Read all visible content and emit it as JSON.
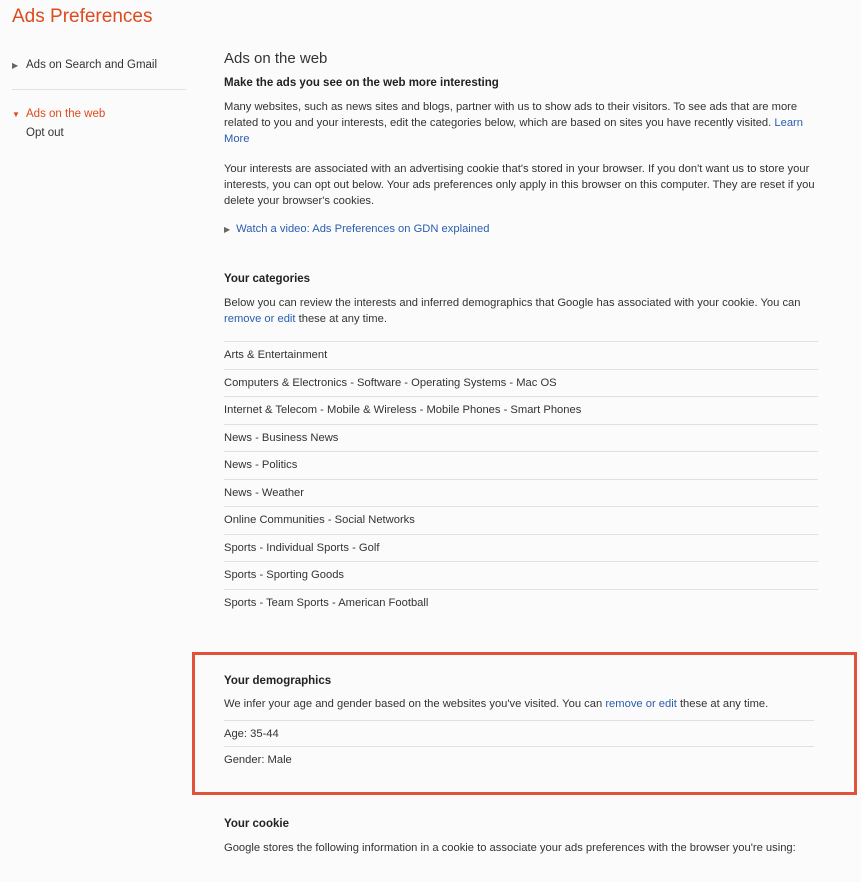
{
  "page": {
    "title": "Ads Preferences"
  },
  "sidebar": {
    "items": [
      {
        "label": "Ads on Search and Gmail"
      },
      {
        "label": "Ads on the web"
      }
    ],
    "sub_items": [
      {
        "label": "Opt out"
      }
    ]
  },
  "main": {
    "title": "Ads on the web",
    "subtitle": "Make the ads you see on the web more interesting",
    "intro": {
      "text": "Many websites, such as news sites and blogs, partner with us to show ads to their visitors. To see ads that are more related to you and your interests, edit the categories below, which are based on sites you have recently visited.",
      "link": "Learn More"
    },
    "cookie_note": "Your interests are associated with an advertising cookie that's stored in your browser. If you don't want us to store your interests, you can opt out below. Your ads preferences only apply in this browser on this computer. They are reset if you delete your browser's cookies.",
    "video_link": "Watch a video: Ads Preferences on GDN explained"
  },
  "categories": {
    "heading": "Your categories",
    "desc_before": "Below you can review the interests and inferred demographics that Google has associated with your cookie. You can",
    "desc_link": "remove or edit",
    "desc_after": "these at any time.",
    "items": [
      "Arts & Entertainment",
      "Computers & Electronics - Software - Operating Systems - Mac OS",
      "Internet & Telecom - Mobile & Wireless - Mobile Phones - Smart Phones",
      "News - Business News",
      "News - Politics",
      "News - Weather",
      "Online Communities - Social Networks",
      "Sports - Individual Sports - Golf",
      "Sports - Sporting Goods",
      "Sports - Team Sports - American Football"
    ]
  },
  "demographics": {
    "heading": "Your demographics",
    "desc_before": "We infer your age and gender based on the websites you've visited. You can",
    "desc_link": "remove or edit",
    "desc_after": "these at any time.",
    "age": "Age: 35-44",
    "gender": "Gender: Male",
    "highlight_color": "#e0533a"
  },
  "cookie": {
    "heading": "Your cookie",
    "desc": "Google stores the following information in a cookie to associate your ads preferences with the browser you're using:"
  },
  "colors": {
    "accent": "#dd4b1e",
    "link": "#2a5db0"
  }
}
